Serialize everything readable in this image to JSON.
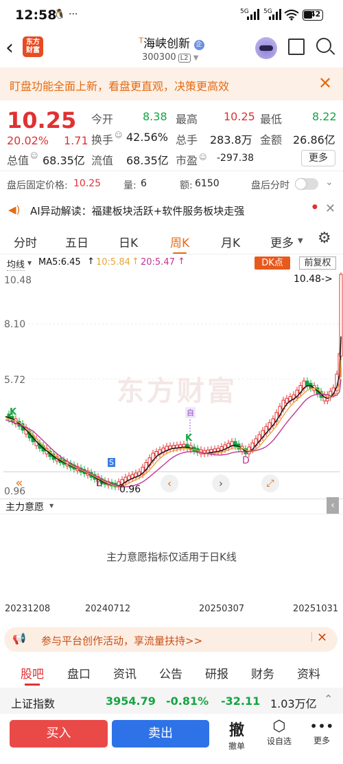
{
  "status": {
    "time": "12:58",
    "battery": "42",
    "signal1": "5G",
    "signal2": "5G"
  },
  "header": {
    "logo_text_1": "东方",
    "logo_text_2": "财富",
    "title_prefix": "T",
    "title": "海峡创新",
    "code": "300300",
    "level": "L2"
  },
  "promo": {
    "text": "盯盘功能全面上新，看盘更直观，决策更高效"
  },
  "quote": {
    "price": "10.25",
    "change_pct": "20.02%",
    "change": "1.71",
    "open_label": "今开",
    "open": "8.38",
    "high_label": "最高",
    "high": "10.25",
    "low_label": "最低",
    "low": "8.22",
    "turnover_label": "换手",
    "turnover": "42.56%",
    "volume_label": "总手",
    "volume": "283.8万",
    "amount_label": "金额",
    "amount": "26.86亿",
    "mktcap_label": "总值",
    "mktcap": "68.35亿",
    "float_label": "流值",
    "float": "68.35亿",
    "pe_label": "市盈",
    "pe": "-297.38",
    "more_label": "更多"
  },
  "after_hours": {
    "price_label": "盘后固定价格:",
    "price": "10.25",
    "vol_label": "量:",
    "vol": "6",
    "amt_label": "额:",
    "amt": "6150",
    "timeshare_label": "盘后分时"
  },
  "ai": {
    "text": "AI异动解读：福建板块活跃+软件服务板块走强"
  },
  "tabs": [
    "分时",
    "五日",
    "日K",
    "周K",
    "月K",
    "更多"
  ],
  "active_tab": "周K",
  "ma": {
    "label": "均线",
    "ma5": "MA5:6.45",
    "ma10": "10:5.84",
    "ma20": "20:5.47",
    "dk_label": "DK点",
    "fq_label": "前复权"
  },
  "chart_data": {
    "type": "candlestick",
    "y_ticks": [
      "10.48",
      "8.10",
      "5.72",
      "0.96"
    ],
    "max_label": "10.48->",
    "min_label": "0.96",
    "watermark": "东方财富",
    "marker_labels": {
      "K": "K",
      "S": "S",
      "D": "D",
      "zi": "自"
    },
    "ma_colors": {
      "ma5": "#111111",
      "ma10": "#e6a43a",
      "ma20": "#c2338f"
    },
    "up_color": "#e03131",
    "down_color": "#15a443"
  },
  "sub": {
    "label": "主力意愿",
    "message": "主力意愿指标仅适用于日K线"
  },
  "dates": [
    "20231208",
    "20240712",
    "20250307",
    "20251031"
  ],
  "banner": {
    "text": "参与平台创作活动，享流量扶持>>"
  },
  "bottom_tabs": [
    "股吧",
    "盘口",
    "资讯",
    "公告",
    "研报",
    "财务",
    "资料"
  ],
  "index": {
    "name": "上证指数",
    "value": "3954.79",
    "pct": "-0.81%",
    "change": "-32.11",
    "amount": "1.03万亿"
  },
  "actions": {
    "buy": "买入",
    "sell": "卖出",
    "cancel": "撤单",
    "cancel_glyph": "撤",
    "watch": "设自选",
    "more": "更多"
  }
}
